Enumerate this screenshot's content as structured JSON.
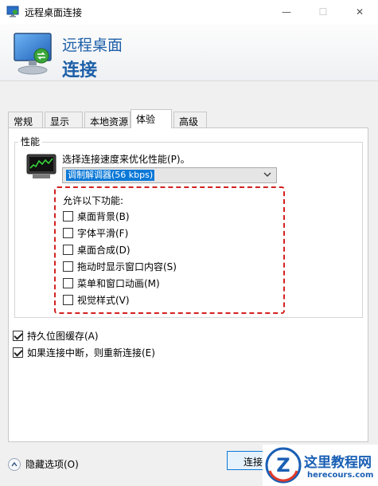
{
  "window": {
    "title": "远程桌面连接",
    "minimize_glyph": "—",
    "maximize_glyph": "☐",
    "close_glyph": "✕"
  },
  "banner": {
    "line1": "远程桌面",
    "line2": "连接"
  },
  "tabs": [
    {
      "label": "常规",
      "active": false
    },
    {
      "label": "显示",
      "active": false
    },
    {
      "label": "本地资源",
      "active": false
    },
    {
      "label": "体验",
      "active": true
    },
    {
      "label": "高级",
      "active": false
    }
  ],
  "performance": {
    "group_label": "性能",
    "speed_label": "选择连接速度来优化性能(P)。",
    "speed_selected": "调制解调器(56 kbps)",
    "allow_label": "允许以下功能:",
    "features": [
      {
        "label": "桌面背景(B)",
        "checked": false
      },
      {
        "label": "字体平滑(F)",
        "checked": false
      },
      {
        "label": "桌面合成(D)",
        "checked": false
      },
      {
        "label": "拖动时显示窗口内容(S)",
        "checked": false
      },
      {
        "label": "菜单和窗口动画(M)",
        "checked": false
      },
      {
        "label": "视觉样式(V)",
        "checked": false
      }
    ]
  },
  "options": [
    {
      "label": "持久位图缓存(A)",
      "checked": true
    },
    {
      "label": "如果连接中断，则重新连接(E)",
      "checked": true
    }
  ],
  "footer": {
    "hide_options_label": "隐藏选项(O)",
    "connect_label": "连接"
  },
  "watermark": {
    "logo_letter": "Z",
    "title": "这里教程网",
    "url": "herecours.com"
  },
  "colors": {
    "accent_blue": "#1d5fa8",
    "highlight_dash": "#d42020",
    "selection": "#0a78d7"
  }
}
